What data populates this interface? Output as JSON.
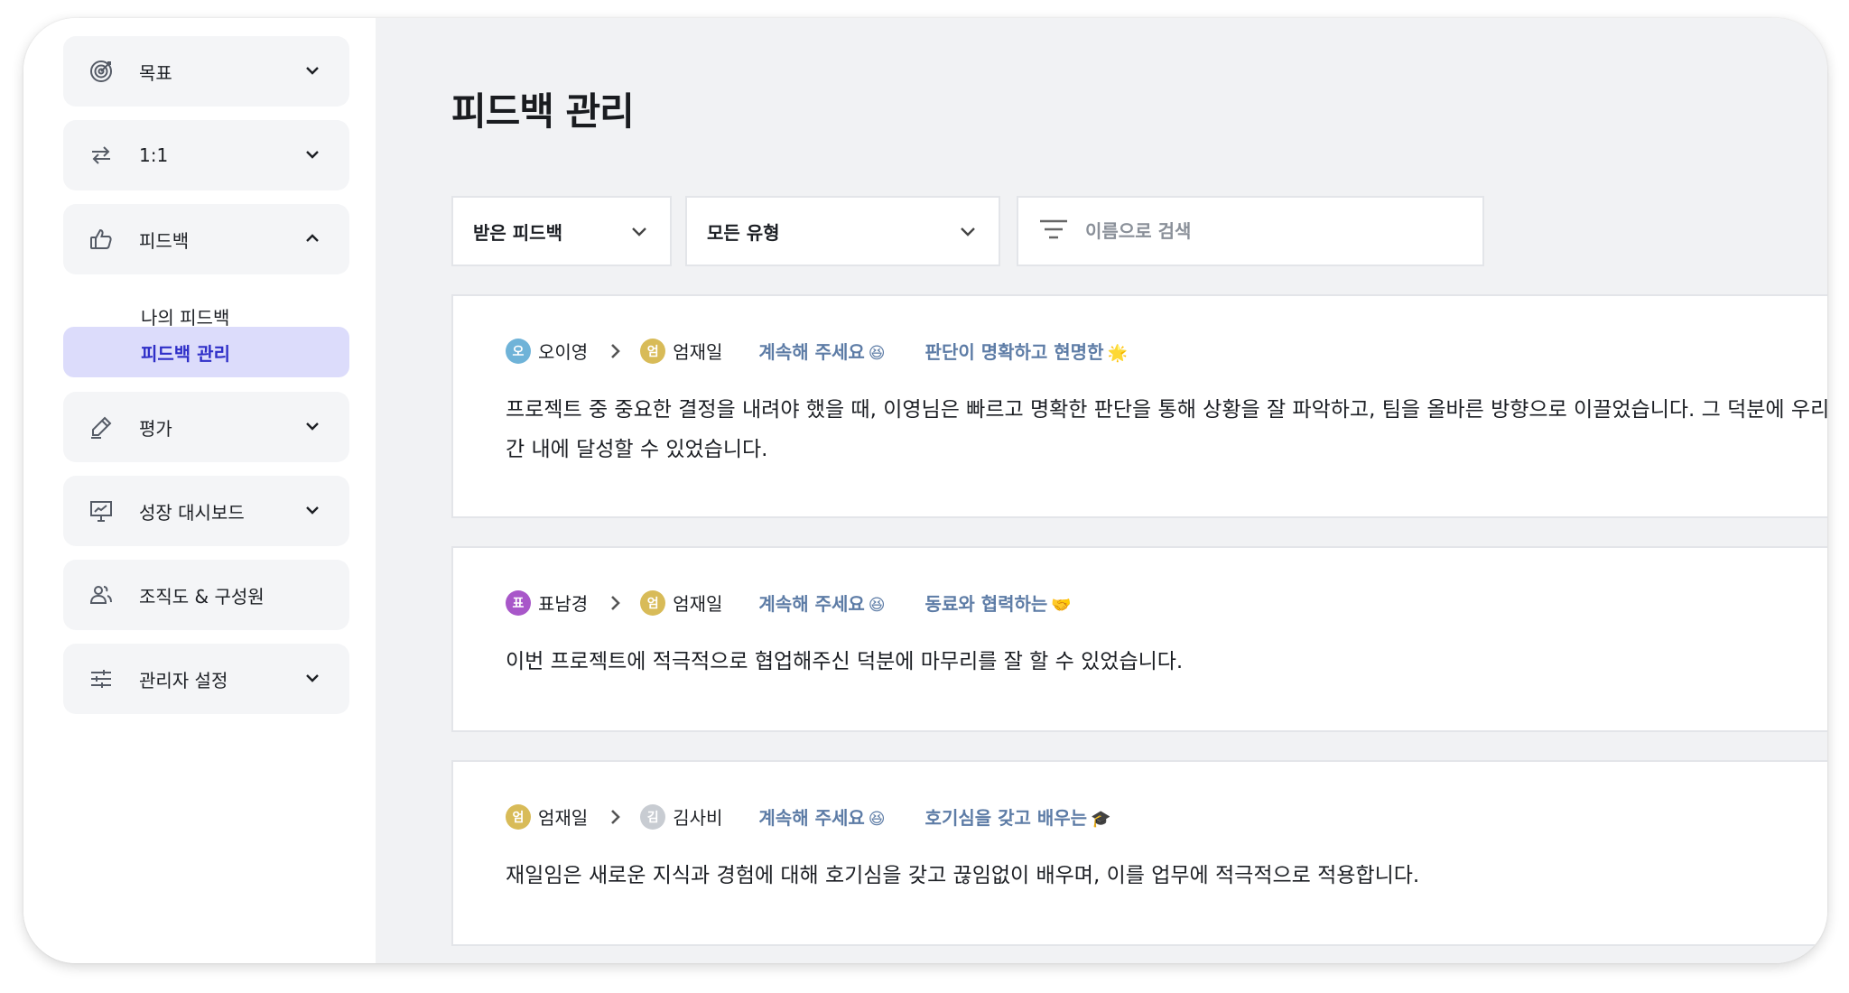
{
  "sidebar": {
    "items": [
      {
        "label": "목표",
        "icon": "target-icon",
        "chevron": "down"
      },
      {
        "label": "1:1",
        "icon": "swap-arrows-icon",
        "chevron": "down"
      },
      {
        "label": "피드백",
        "icon": "thumbs-up-icon",
        "chevron": "up"
      },
      {
        "label": "평가",
        "icon": "pen-edit-icon",
        "chevron": "down"
      },
      {
        "label": "성장 대시보드",
        "icon": "presentation-chart-icon",
        "chevron": "down"
      },
      {
        "label": "조직도 & 구성원",
        "icon": "users-icon",
        "chevron": "none"
      },
      {
        "label": "관리자 설정",
        "icon": "sliders-icon",
        "chevron": "down"
      }
    ],
    "feedback_sub": [
      {
        "label": "나의 피드백",
        "active": false
      },
      {
        "label": "피드백 관리",
        "active": true
      }
    ]
  },
  "main": {
    "title": "피드백 관리",
    "filters": {
      "direction": "받은 피드백",
      "type": "모든 유형",
      "search_placeholder": "이름으로 검색"
    },
    "cards": [
      {
        "from": {
          "initial": "오",
          "name": "오이영",
          "color": "#6fb3d8"
        },
        "to": {
          "initial": "엄",
          "name": "엄재일",
          "color": "#d8bb58"
        },
        "tag1": "계속해 주세요",
        "tag1_emoji": "😆",
        "tag2": "판단이 명확하고 현명한",
        "tag2_emoji": "🌟",
        "lines": [
          "프로젝트 중 중요한 결정을 내려야 했을 때, 이영님은 빠르고 명확한 판단을 통해 상황을 잘 파악하고, 팀을 올바른 방향으로 이끌었습니다. 그 덕분에 우리가",
          "간 내에 달성할 수 있었습니다."
        ]
      },
      {
        "from": {
          "initial": "표",
          "name": "표남경",
          "color": "#a857c9"
        },
        "to": {
          "initial": "엄",
          "name": "엄재일",
          "color": "#d8bb58"
        },
        "tag1": "계속해 주세요",
        "tag1_emoji": "😆",
        "tag2": "동료와 협력하는",
        "tag2_emoji": "🤝",
        "lines": [
          "이번 프로젝트에 적극적으로 협업해주신 덕분에 마무리를 잘 할 수 있었습니다."
        ]
      },
      {
        "from": {
          "initial": "엄",
          "name": "엄재일",
          "color": "#d8bb58"
        },
        "to": {
          "initial": "김",
          "name": "김사비",
          "color": "#c8ccd2"
        },
        "tag1": "계속해 주세요",
        "tag1_emoji": "😆",
        "tag2": "호기심을 갖고 배우는",
        "tag2_emoji": "🎓",
        "lines": [
          "재일임은 새로운 지식과 경험에 대해 호기심을 갖고 끊임없이 배우며, 이를 업무에 적극적으로 적용합니다."
        ]
      }
    ]
  }
}
